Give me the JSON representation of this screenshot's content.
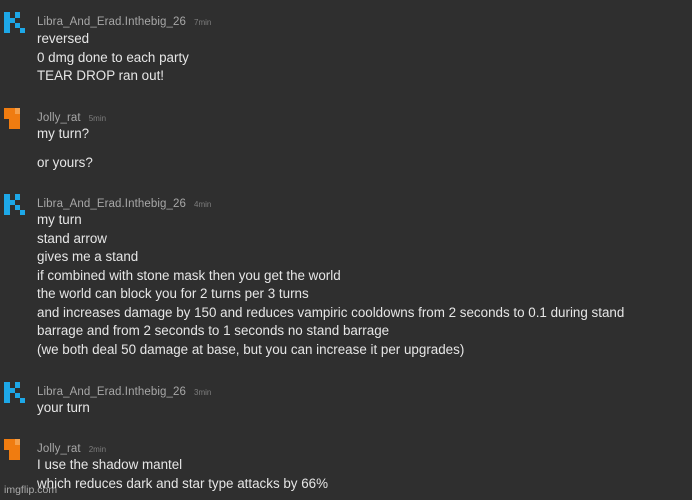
{
  "messages": [
    {
      "username": "Libra_And_Erad.Inthebig_26",
      "timestamp": "7min",
      "avatar": "blue-pixel-avatar-icon",
      "avatar_color": "#1da8e8",
      "lines": [
        "reversed",
        "0 dmg done to each party",
        "TEAR DROP ran out!"
      ]
    },
    {
      "username": "Jolly_rat",
      "timestamp": "5min",
      "avatar": "orange-pixel-avatar-icon",
      "avatar_color": "#f07c10",
      "lines": [
        "my turn?"
      ],
      "followup": "or yours?"
    },
    {
      "username": "Libra_And_Erad.Inthebig_26",
      "timestamp": "4min",
      "avatar": "blue-pixel-avatar-icon",
      "avatar_color": "#1da8e8",
      "lines": [
        "my turn",
        "stand arrow",
        "gives me a stand",
        "if combined with stone mask then you get the world",
        "the world can block you for 2 turns per 3 turns",
        "and increases damage by 150 and reduces vampiric cooldowns from 2 seconds to 0.1 during stand",
        "barrage and from 2 seconds to 1 seconds no stand barrage",
        "(we both deal 50 damage at base, but you can increase it per upgrades)"
      ]
    },
    {
      "username": "Libra_And_Erad.Inthebig_26",
      "timestamp": "3min",
      "avatar": "blue-pixel-avatar-icon",
      "avatar_color": "#1da8e8",
      "lines": [
        "your turn"
      ]
    },
    {
      "username": "Jolly_rat",
      "timestamp": "2min",
      "avatar": "orange-pixel-avatar-icon",
      "avatar_color": "#f07c10",
      "lines": [
        "I use the shadow mantel",
        "which reduces dark and star type attacks by 66%"
      ]
    }
  ],
  "watermark": "imgflip.com"
}
